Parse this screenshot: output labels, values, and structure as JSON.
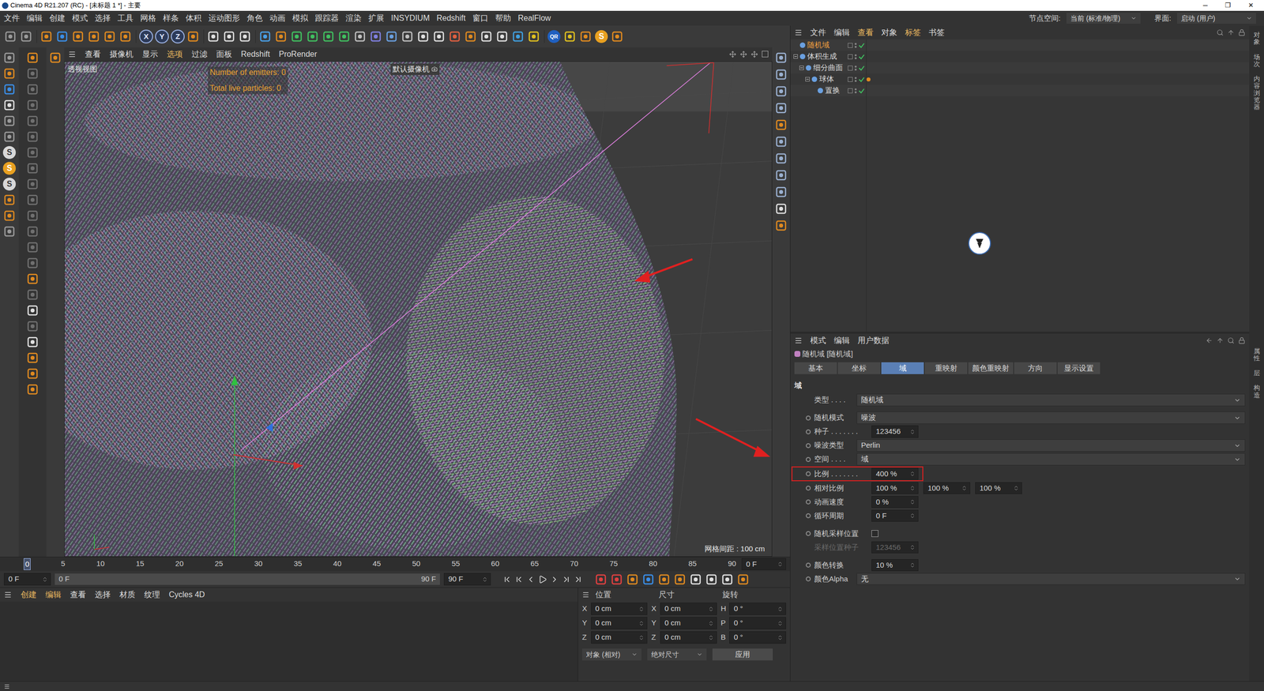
{
  "window": {
    "title": "Cinema 4D R21.207 (RC) - [未标题 1 *] - 主要",
    "controls": [
      "─",
      "❐",
      "✕"
    ]
  },
  "menubar": {
    "items": [
      "文件",
      "编辑",
      "创建",
      "模式",
      "选择",
      "工具",
      "网格",
      "样条",
      "体积",
      "运动图形",
      "角色",
      "动画",
      "模拟",
      "跟踪器",
      "渲染",
      "扩展",
      "INSYDIUM",
      "Redshift",
      "窗口",
      "帮助",
      "RealFlow"
    ],
    "node_space": {
      "label": "节点空间:",
      "value": "当前 (标准/物理)"
    },
    "interface": {
      "label": "界面:",
      "value": "启动 (用户)"
    }
  },
  "toolbar": {
    "axes": [
      {
        "label": "X",
        "on": true
      },
      {
        "label": "Y",
        "on": true
      },
      {
        "label": "Z",
        "on": true
      }
    ],
    "logos": [
      "QR",
      "S"
    ]
  },
  "left_tools": {
    "logos": [
      "S",
      "S",
      "S"
    ]
  },
  "viewport": {
    "menu": [
      {
        "label": "查看",
        "highlight": false
      },
      {
        "label": "摄像机",
        "highlight": false
      },
      {
        "label": "显示",
        "highlight": false
      },
      {
        "label": "选项",
        "highlight": true
      },
      {
        "label": "过滤",
        "highlight": false
      },
      {
        "label": "面板",
        "highlight": false
      },
      {
        "label": "Redshift",
        "highlight": false
      },
      {
        "label": "ProRender",
        "highlight": false
      }
    ],
    "name": "透视视图",
    "hud": [
      "Number of emitters: 0",
      "Total live particles: 0"
    ],
    "camera": "默认摄像机",
    "grid": "网格间距 : 100 cm"
  },
  "timeline": {
    "ticks": [
      "0",
      "5",
      "10",
      "15",
      "20",
      "25",
      "30",
      "35",
      "40",
      "45",
      "50",
      "55",
      "60",
      "65",
      "70",
      "75",
      "80",
      "85",
      "90"
    ],
    "current_tick": "0",
    "current_frame": "0 F",
    "start": "0 F",
    "range_start": "0 F",
    "range_end": "90 F",
    "end": "90 F"
  },
  "materials": {
    "menu": [
      {
        "label": "创建",
        "highlight": true
      },
      {
        "label": "编辑",
        "highlight": true
      },
      {
        "label": "查看",
        "highlight": false
      },
      {
        "label": "选择",
        "highlight": false
      },
      {
        "label": "材质",
        "highlight": false
      },
      {
        "label": "纹理",
        "highlight": false
      },
      {
        "label": "Cycles 4D",
        "highlight": false
      }
    ]
  },
  "coordinates": {
    "headers": [
      "位置",
      "尺寸",
      "旋转"
    ],
    "rows": [
      {
        "axis": "X",
        "position": "0 cm",
        "size_axis": "X",
        "size": "0 cm",
        "rot_axis": "H",
        "rotation": "0 °"
      },
      {
        "axis": "Y",
        "position": "0 cm",
        "size_axis": "Y",
        "size": "0 cm",
        "rot_axis": "P",
        "rotation": "0 °"
      },
      {
        "axis": "Z",
        "position": "0 cm",
        "size_axis": "Z",
        "size": "0 cm",
        "rot_axis": "B",
        "rotation": "0 °"
      }
    ],
    "mode": "对象 (相对)",
    "size_mode": "绝对尺寸",
    "apply": "应用"
  },
  "object_manager": {
    "menu": [
      {
        "label": "文件",
        "highlight": false
      },
      {
        "label": "编辑",
        "highlight": false
      },
      {
        "label": "查看",
        "highlight": true
      },
      {
        "label": "对象",
        "highlight": false
      },
      {
        "label": "标签",
        "highlight": true
      },
      {
        "label": "书签",
        "highlight": false
      }
    ],
    "objects": [
      {
        "name": "随机域",
        "depth": 0,
        "selected": true,
        "expandable": false,
        "expanded": false,
        "enabled": true,
        "has_tag": false
      },
      {
        "name": "体积生成",
        "depth": 0,
        "selected": false,
        "expandable": true,
        "expanded": true,
        "enabled": true,
        "has_tag": false
      },
      {
        "name": "细分曲面",
        "depth": 1,
        "selected": false,
        "expandable": true,
        "expanded": true,
        "enabled": true,
        "has_tag": false
      },
      {
        "name": "球体",
        "depth": 2,
        "selected": false,
        "expandable": true,
        "expanded": true,
        "enabled": true,
        "has_tag": true
      },
      {
        "name": "置换",
        "depth": 3,
        "selected": false,
        "expandable": false,
        "expanded": false,
        "enabled": true,
        "has_tag": false
      }
    ]
  },
  "attributes": {
    "menu": [
      "模式",
      "编辑",
      "用户数据"
    ],
    "title": "随机域 [随机域]",
    "tabs": [
      {
        "label": "基本",
        "selected": false
      },
      {
        "label": "坐标",
        "selected": false
      },
      {
        "label": "域",
        "selected": true
      },
      {
        "label": "重映射",
        "selected": false
      },
      {
        "label": "颜色重映射",
        "selected": false
      },
      {
        "label": "方向",
        "selected": false
      },
      {
        "label": "显示设置",
        "selected": false
      }
    ],
    "section": "域",
    "groups": [
      [
        {
          "label": "类型 . . . .",
          "kind": "dropdown",
          "value": "随机域",
          "keyable": false,
          "highlighted": false,
          "disabled": false
        }
      ],
      [
        {
          "label": "随机模式",
          "kind": "dropdown",
          "value": "噪波",
          "keyable": true,
          "highlighted": false,
          "disabled": false
        },
        {
          "label": "种子 . . . . . . .",
          "kind": "number",
          "value": "123456",
          "keyable": true,
          "highlighted": false,
          "disabled": false
        },
        {
          "label": "噪波类型",
          "kind": "dropdown",
          "value": "Perlin",
          "keyable": true,
          "highlighted": false,
          "disabled": false
        },
        {
          "label": "空间 . . . .",
          "kind": "dropdown",
          "value": "域",
          "keyable": true,
          "highlighted": false,
          "disabled": false
        },
        {
          "label": "比例 . . . . . . .",
          "kind": "number",
          "value": "400 %",
          "keyable": true,
          "highlighted": true,
          "disabled": false
        },
        {
          "label": "相对比例",
          "kind": "triple",
          "values": [
            "100 %",
            "100 %",
            "100 %"
          ],
          "keyable": true,
          "highlighted": false,
          "disabled": false
        },
        {
          "label": "动画速度",
          "kind": "number",
          "value": "0 %",
          "keyable": true,
          "highlighted": false,
          "disabled": false
        },
        {
          "label": "循环周期",
          "kind": "number",
          "value": "0 F",
          "keyable": true,
          "highlighted": false,
          "disabled": false
        }
      ],
      [
        {
          "label": "随机采样位置",
          "kind": "checkbox",
          "checked": false,
          "keyable": true,
          "highlighted": false,
          "disabled": false
        },
        {
          "label": "采样位置种子",
          "kind": "number",
          "value": "123456",
          "keyable": false,
          "highlighted": false,
          "disabled": true
        }
      ],
      [
        {
          "label": "颜色转换",
          "kind": "number",
          "value": "10 %",
          "keyable": true,
          "highlighted": false,
          "disabled": false
        },
        {
          "label": "颜色Alpha",
          "kind": "dropdown",
          "value": "无",
          "keyable": true,
          "highlighted": false,
          "disabled": false
        }
      ]
    ]
  },
  "side_tabs": {
    "top": [
      "对象",
      "场次",
      "内容浏览器"
    ],
    "bottom": [
      "属性",
      "层",
      "构造"
    ]
  }
}
